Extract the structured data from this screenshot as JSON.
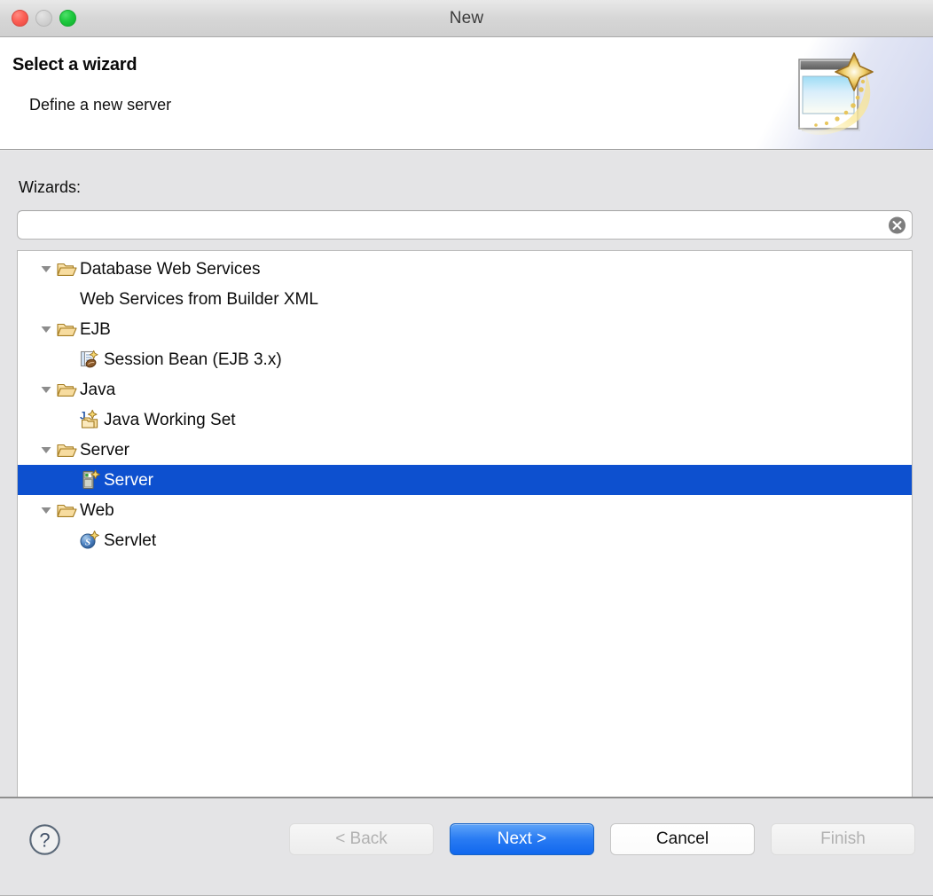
{
  "window": {
    "title": "New",
    "traffic_lights": [
      {
        "name": "close",
        "color": "#fc5f55",
        "enabled": true
      },
      {
        "name": "minimize",
        "color": "#d3d3d3",
        "enabled": false
      },
      {
        "name": "zoom",
        "color": "#1ec93e",
        "enabled": true
      }
    ]
  },
  "banner": {
    "title": "Select a wizard",
    "subtitle": "Define a new server",
    "icon": "wizard-window-sparkle-icon"
  },
  "form": {
    "wizards_label": "Wizards:",
    "search": {
      "value": "",
      "placeholder": "",
      "clear_icon": "clear-circle-x-icon"
    }
  },
  "tree": {
    "selected_index": 8,
    "items": [
      {
        "level": 0,
        "label": "Database Web Services",
        "expanded": true,
        "icon": "open-folder-icon",
        "selected": false
      },
      {
        "level": 1,
        "label": "Web Services from Builder XML",
        "icon": "",
        "selected": false
      },
      {
        "level": 0,
        "label": "EJB",
        "expanded": true,
        "icon": "open-folder-icon",
        "selected": false
      },
      {
        "level": 1,
        "label": "Session Bean (EJB 3.x)",
        "icon": "session-bean-new-icon",
        "selected": false
      },
      {
        "level": 0,
        "label": "Java",
        "expanded": true,
        "icon": "open-folder-icon",
        "selected": false
      },
      {
        "level": 1,
        "label": "Java Working Set",
        "icon": "java-working-set-new-icon",
        "selected": false
      },
      {
        "level": 0,
        "label": "Server",
        "expanded": true,
        "icon": "open-folder-icon",
        "selected": false
      },
      {
        "level": 1,
        "label": "Server",
        "icon": "server-new-icon",
        "selected": true
      },
      {
        "level": 0,
        "label": "Web",
        "expanded": true,
        "icon": "open-folder-icon",
        "selected": false
      },
      {
        "level": 1,
        "label": "Servlet",
        "icon": "servlet-new-icon",
        "selected": false
      }
    ]
  },
  "footer": {
    "help_icon": "help-question-icon",
    "buttons": [
      {
        "name": "back",
        "label": "< Back",
        "state": "disabled"
      },
      {
        "name": "next",
        "label": "Next >",
        "state": "default"
      },
      {
        "name": "cancel",
        "label": "Cancel",
        "state": "normal"
      },
      {
        "name": "finish",
        "label": "Finish",
        "state": "disabled"
      }
    ]
  },
  "colors": {
    "selection_blue": "#0d50cf",
    "default_button_blue": "#2a7cf3",
    "window_bg": "#e4e4e6",
    "panel_white": "#ffffff"
  }
}
